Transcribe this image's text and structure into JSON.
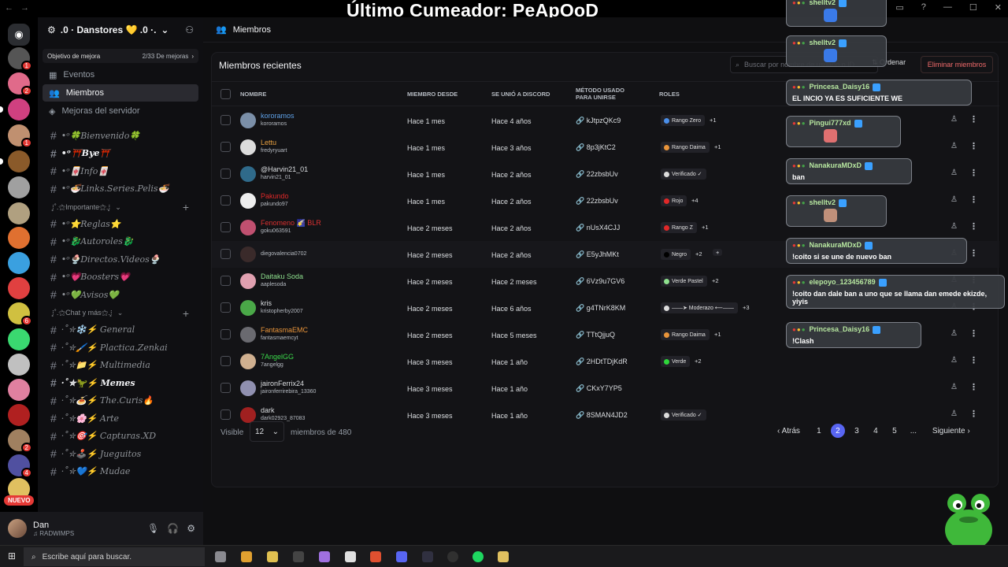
{
  "overlay": {
    "title": "Último Cumeador: PeApOoD"
  },
  "server": {
    "name": ".0 · Danstores 💛 .0 ·.",
    "boost_label": "Objetivo de mejora",
    "boost_progress": "2/33 De mejoras"
  },
  "nav": {
    "events": "Eventos",
    "members": "Miembros",
    "boosts": "Mejoras del servidor"
  },
  "channels_top": [
    {
      "label": "•ᵒ🍀Bienvenido🍀"
    },
    {
      "label": "•ᵒ⛩️Bye⛩️"
    },
    {
      "label": "•ᵒ🀄Info🀄"
    },
    {
      "label": "•ᵒ🍜Links.Series.Pelis🍜"
    }
  ],
  "category_important": "⁝̥˚.⚝Importante⚝.⁝̥",
  "channels_important": [
    {
      "label": "•ᵒ⭐Reglas⭐"
    },
    {
      "label": "•ᵒ🐉Autoroles🐉"
    },
    {
      "label": "•ᵒ🍨Directos.Videos🍨"
    },
    {
      "label": "•ᵒ💗Boosters💗"
    },
    {
      "label": "•ᵒ💚Avisos💚"
    }
  ],
  "category_chat": "⁝̥˚.⚝Chat y más⚝.⁝̥",
  "channels_chat": [
    {
      "label": "·˚✮❄️⚡ General"
    },
    {
      "label": "·˚✮🖌️⚡ Plactica.Zenkai"
    },
    {
      "label": "·˚✮📁⚡ Multimedia"
    },
    {
      "label": "·˚✮🦖⚡ Memes"
    },
    {
      "label": "·˚✮🍝⚡ The.Curis🔥"
    },
    {
      "label": "·˚✮🌸⚡ Arte"
    },
    {
      "label": "·˚✮🎯⚡ Capturas.XD"
    },
    {
      "label": "·˚✮🕹️⚡ Jueguitos"
    },
    {
      "label": "·˚✮💙⚡ Mudae"
    }
  ],
  "user": {
    "name": "Dan",
    "status": "♫ RADWIMPS"
  },
  "rail_badge_new": "NUEVO",
  "main": {
    "header": "Miembros",
    "panel_title": "Miembros recientes",
    "search_placeholder": "Buscar por nombre de usuario o ID",
    "sort_label": "Ordenar",
    "delete_label": "Eliminar miembros"
  },
  "columns": {
    "name": "NOMBRE",
    "member_since": "MIEMBRO DESDE",
    "joined_discord": "SE UNIÓ A DISCORD",
    "join_method": "MÉTODO USADO PARA UNIRSE",
    "roles": "ROLES"
  },
  "members": [
    {
      "display": "kororamos",
      "user": "kororamos",
      "name_color": "#5ea0e6",
      "since": "Hace 1 mes",
      "joined": "Hace 4 años",
      "invite": "🔗 kJtpzQKc9",
      "role": "Rango Zero",
      "role_color": "#4a8ee8",
      "more": "+1",
      "avatar": "#7b8fa8"
    },
    {
      "display": "Lettu",
      "user": "fredyryuart",
      "name_color": "#e8a040",
      "since": "Hace 1 mes",
      "joined": "Hace 3 años",
      "invite": "🔗 8p3jKtC2",
      "role": "Rango Daima",
      "role_color": "#e8943a",
      "more": "+1",
      "avatar": "#dcdcdc"
    },
    {
      "display": "@Harvin21_01",
      "user": "harvin21_01",
      "name_color": "#dbdee1",
      "since": "Hace 1 mes",
      "joined": "Hace 2 años",
      "invite": "🔗 22zbsbUv",
      "role": "Verificado ✓",
      "role_color": "#dcdcdc",
      "more": "",
      "avatar": "#2f6a8a"
    },
    {
      "display": "Pakundo",
      "user": "pakundo97",
      "name_color": "#e02828",
      "since": "Hace 1 mes",
      "joined": "Hace 2 años",
      "invite": "🔗 22zbsbUv",
      "role": "Rojo",
      "role_color": "#e02828",
      "more": "+4",
      "avatar": "#eeeeee"
    },
    {
      "display": "Fenomeno 🌠 BLR",
      "user": "goku063591",
      "name_color": "#d83030",
      "since": "Hace 2 meses",
      "joined": "Hace 2 años",
      "invite": "🔗 nUsX4CJJ",
      "role": "Rango Z",
      "role_color": "#e02828",
      "more": "+1",
      "avatar": "#c05070"
    },
    {
      "display": "",
      "user": "diegovalencia0702",
      "name_color": "#dbdee1",
      "since": "Hace 2 meses",
      "joined": "Hace 2 años",
      "invite": "🔗 E5yJhMKt",
      "role": "Negro",
      "role_color": "#000000",
      "more": "+2",
      "avatar": "#3a2a2a"
    },
    {
      "display": "Daitaku Soda",
      "user": "aaplesoda",
      "name_color": "#8ee08e",
      "since": "Hace 2 meses",
      "joined": "Hace 2 meses",
      "invite": "🔗 6Vz9u7GV6",
      "role": "Verde Pastel",
      "role_color": "#8ee08e",
      "more": "+2",
      "avatar": "#e0a0b0"
    },
    {
      "display": "kris",
      "user": "kristopherby2007",
      "name_color": "#dbdee1",
      "since": "Hace 2 meses",
      "joined": "Hace 6 años",
      "invite": "🔗 g4TNrK8KM",
      "role": "——➤ Moderazo ⟵——",
      "role_color": "#dcdcdc",
      "more": "+3",
      "avatar": "#4aa848"
    },
    {
      "display": "FantasmaEMC",
      "user": "fantasmaemcyt",
      "name_color": "#e8943a",
      "since": "Hace 2 meses",
      "joined": "Hace 5 meses",
      "invite": "🔗 TTtQjjuQ",
      "role": "Rango Daima",
      "role_color": "#e8943a",
      "more": "+1",
      "avatar": "#6a6a70"
    },
    {
      "display": "7AngelGG",
      "user": "7angelgg",
      "name_color": "#3ad84a",
      "since": "Hace 3 meses",
      "joined": "Hace 1 año",
      "invite": "🔗 2HDtTDjKdR",
      "role": "Verde",
      "role_color": "#2ed63a",
      "more": "+2",
      "avatar": "#d0b090"
    },
    {
      "display": "jaironFerrix24",
      "user": "jaironferrirebira_13360",
      "name_color": "#dbdee1",
      "since": "Hace 3 meses",
      "joined": "Hace 1 año",
      "invite": "🔗 CKxY7YP5",
      "role": "",
      "role_color": "",
      "more": "",
      "avatar": "#9090b0"
    },
    {
      "display": "dark",
      "user": "dark02923_87083",
      "name_color": "#dbdee1",
      "since": "Hace 3 meses",
      "joined": "Hace 1 año",
      "invite": "🔗 8SMAN4JD2",
      "role": "Verificado ✓",
      "role_color": "#dcdcdc",
      "more": "",
      "avatar": "#a02020"
    }
  ],
  "footer": {
    "visible_label": "Visible",
    "per_page": "12",
    "total_label": "miembros de 480",
    "prev": "Atrás",
    "next": "Siguiente",
    "pages": [
      "1",
      "2",
      "3",
      "4",
      "5",
      "..."
    ],
    "current_page": "2"
  },
  "chat": [
    {
      "user": "shelltv2",
      "msg": "",
      "emote": "#3a7ae8",
      "color": "#b7e7a0"
    },
    {
      "user": "shelltv2",
      "msg": "",
      "emote": "#3a7ae8",
      "color": "#b7e7a0"
    },
    {
      "user": "Princesa_Daisy16",
      "msg": "EL INCIO YA ES SUFICIENTE WE",
      "emote": "",
      "color": "#b7e7a0"
    },
    {
      "user": "Pingui777xd",
      "msg": "",
      "emote": "#e07070",
      "color": "#b7e7a0"
    },
    {
      "user": "NanakuraMDxD",
      "msg": "ban",
      "emote": "",
      "color": "#b7e7a0"
    },
    {
      "user": "shelltv2",
      "msg": "",
      "emote": "#c0907a",
      "color": "#b7e7a0"
    },
    {
      "user": "NanakuraMDxD",
      "msg": "!coito si se une de nuevo ban",
      "emote": "",
      "color": "#b7e7a0"
    },
    {
      "user": "elepoyo_123456789",
      "msg": "!coito dan dale ban a uno que se llama dan emede ekizde, yiyis",
      "emote": "",
      "color": "#b7e7a0"
    },
    {
      "user": "Princesa_Daisy16",
      "msg": "!Clash",
      "emote": "",
      "color": "#b7e7a0"
    }
  ],
  "taskbar": {
    "search_placeholder": "Escribe aquí para buscar."
  }
}
